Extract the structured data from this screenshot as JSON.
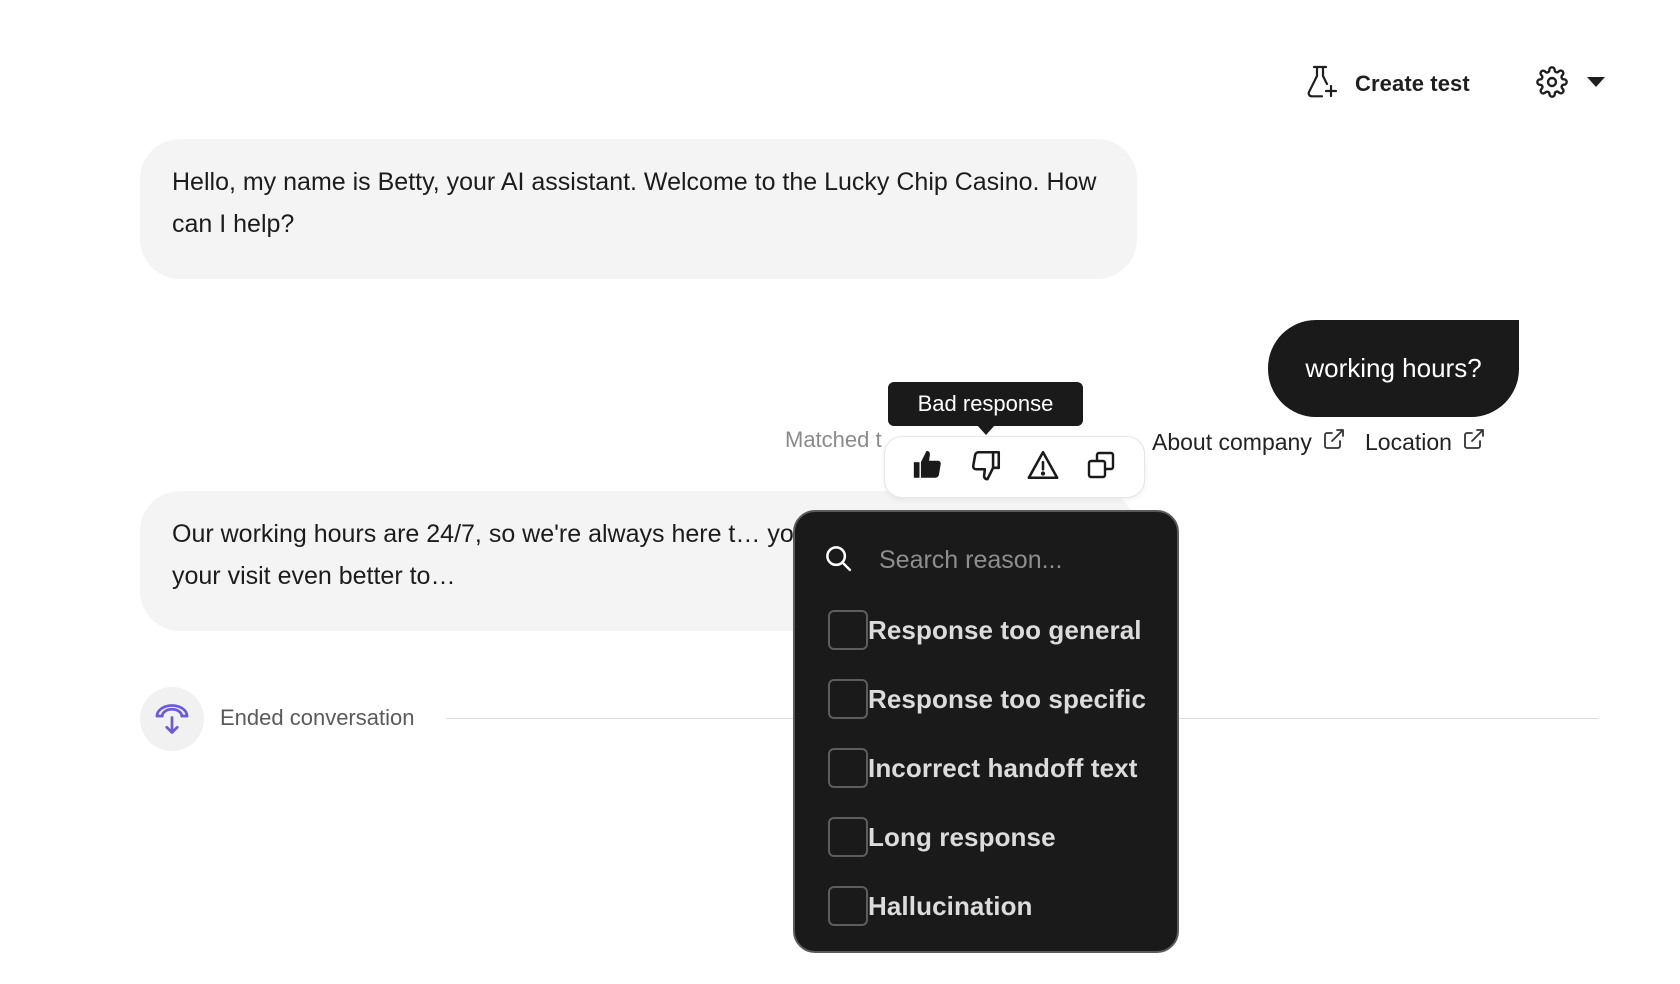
{
  "toolbar": {
    "create_test_label": "Create test"
  },
  "conversation": {
    "messages": [
      {
        "role": "assistant",
        "text": "Hello, my name is Betty, your AI assistant. Welcome to the Lucky Chip Casino. How can I help?"
      },
      {
        "role": "user",
        "text": "working hours?"
      },
      {
        "role": "assistant",
        "text": "Our working hours are 24/7, so we're always here t… you need! How can I make your visit even better to…"
      }
    ],
    "matched_topics_label": "Matched t",
    "topics": [
      {
        "label": "About company"
      },
      {
        "label": "Location"
      }
    ],
    "ended_label": "Ended conversation"
  },
  "feedback": {
    "tooltip": "Bad response"
  },
  "reason_dropdown": {
    "search_placeholder": "Search reason...",
    "options": [
      {
        "label": "Response too general",
        "checked": false
      },
      {
        "label": "Response too specific",
        "checked": false
      },
      {
        "label": "Incorrect handoff text",
        "checked": false
      },
      {
        "label": "Long response",
        "checked": false
      },
      {
        "label": "Hallucination",
        "checked": false
      }
    ]
  },
  "colors": {
    "accent": "#6b5bd6",
    "user_bubble": "#1a1a1a",
    "assistant_bubble": "#f4f4f4",
    "dropdown_bg": "#1a1a1a"
  },
  "icons": {
    "create_test": "flask-plus-icon",
    "settings": "gear-icon",
    "settings_menu": "caret-down-icon",
    "external": "external-link-icon",
    "thumbs_up": "thumbs-up-icon",
    "thumbs_down": "thumbs-down-icon",
    "warning": "warning-icon",
    "copy": "copy-icon",
    "search": "search-icon",
    "ended": "handoff-icon"
  }
}
